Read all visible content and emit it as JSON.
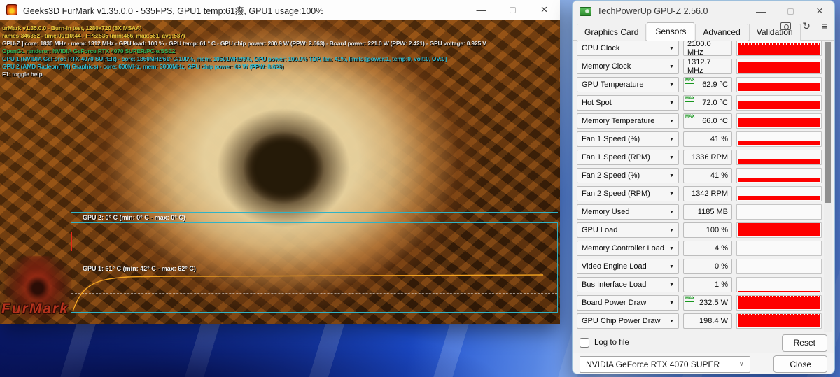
{
  "furmark": {
    "title": "Geeks3D FurMark v1.35.0.0 - 535FPS, GPU1 temp:61癈, GPU1 usage:100%",
    "overlay_lines": [
      {
        "text": "urMark v1.35.0.0 - Burn-in test, 1280x720 (8X MSAA)",
        "color": "#e6c83c"
      },
      {
        "text": "rames:346352 - time:00:10:44 - FPS:535 (min:466, max:561, avg:537)",
        "color": "#e6c83c"
      },
      {
        "text": "GPU-Z ] core: 1830 MHz - mem: 1312 MHz - GPU load: 100 % - GPU temp: 61 ° C - GPU chip power: 200.9 W (PPW: 2.663) - Board power: 221.0 W (PPW: 2.421) - GPU voltage: 0.925 V",
        "color": "#e2e2e2"
      },
      {
        "text": "OpenGL renderer: NVIDIA GeForce RTX 4070 SUPER/PCIe/SSE2",
        "color": "#2fae57"
      },
      {
        "text": "GPU 1 (NVIDIA GeForce RTX 4070 SUPER) - core: 1860MHz/61° C/100%, mem: 10501MHz/9%, GPU power: 100.0% TDP, fan: 41%, limits:[power:1, temp:0, volt:0, OV:0]",
        "color": "#2fb9cf"
      },
      {
        "text": "GPU 2 (AMD Radeon(TM) Graphics) - core: 600MHz, mem: 3000MHz, GPU chip power: 62 W (PPW: 8.629)",
        "color": "#2fb9cf"
      },
      {
        "text": "F1: toggle help",
        "color": "#d8d8d8"
      }
    ],
    "graph": {
      "gpu2_label": "GPU 2: 0° C (min: 0° C - max: 0° C)",
      "gpu1_label": "GPU 1: 61° C (min: 42° C - max: 62° C)",
      "line_color": "#f5a623"
    },
    "logo_text": "FurMark"
  },
  "gpuz": {
    "title": "TechPowerUp GPU-Z 2.56.0",
    "tabs": [
      "Graphics Card",
      "Sensors",
      "Advanced",
      "Validation"
    ],
    "active_tab": "Sensors",
    "max_badge": "MAX",
    "graph_color": "#fe0000",
    "sensors": [
      {
        "label": "GPU Clock",
        "value": "2100.0 MHz",
        "max": false,
        "fill": 66,
        "jagged": true
      },
      {
        "label": "Memory Clock",
        "value": "1312.7 MHz",
        "max": false,
        "fill": 74,
        "jagged": false
      },
      {
        "label": "GPU Temperature",
        "value": "62.9 °C",
        "max": true,
        "fill": 55,
        "jagged": false
      },
      {
        "label": "Hot Spot",
        "value": "72.0 °C",
        "max": true,
        "fill": 62,
        "jagged": false
      },
      {
        "label": "Memory Temperature",
        "value": "66.0 °C",
        "max": true,
        "fill": 65,
        "jagged": false
      },
      {
        "label": "Fan 1 Speed (%)",
        "value": "41 %",
        "max": false,
        "fill": 28,
        "jagged": false
      },
      {
        "label": "Fan 1 Speed (RPM)",
        "value": "1336 RPM",
        "max": false,
        "fill": 32,
        "jagged": false
      },
      {
        "label": "Fan 2 Speed (%)",
        "value": "41 %",
        "max": false,
        "fill": 30,
        "jagged": false
      },
      {
        "label": "Fan 2 Speed (RPM)",
        "value": "1342 RPM",
        "max": false,
        "fill": 32,
        "jagged": false
      },
      {
        "label": "Memory Used",
        "value": "1185 MB",
        "max": false,
        "fill": 4,
        "jagged": false
      },
      {
        "label": "GPU Load",
        "value": "100 %",
        "max": false,
        "fill": 100,
        "jagged": false
      },
      {
        "label": "Memory Controller Load",
        "value": "4 %",
        "max": false,
        "fill": 2,
        "jagged": false
      },
      {
        "label": "Video Engine Load",
        "value": "0 %",
        "max": false,
        "fill": 0,
        "jagged": false
      },
      {
        "label": "Bus Interface Load",
        "value": "1 %",
        "max": false,
        "fill": 1,
        "jagged": false
      },
      {
        "label": "Board Power Draw",
        "value": "232.5 W",
        "max": true,
        "fill": 88,
        "jagged": true
      },
      {
        "label": "GPU Chip Power Draw",
        "value": "198.4 W",
        "max": false,
        "fill": 85,
        "jagged": true
      }
    ],
    "log_to_file": "Log to file",
    "reset_button": "Reset",
    "device_select": "NVIDIA GeForce RTX 4070 SUPER",
    "close_button": "Close"
  }
}
